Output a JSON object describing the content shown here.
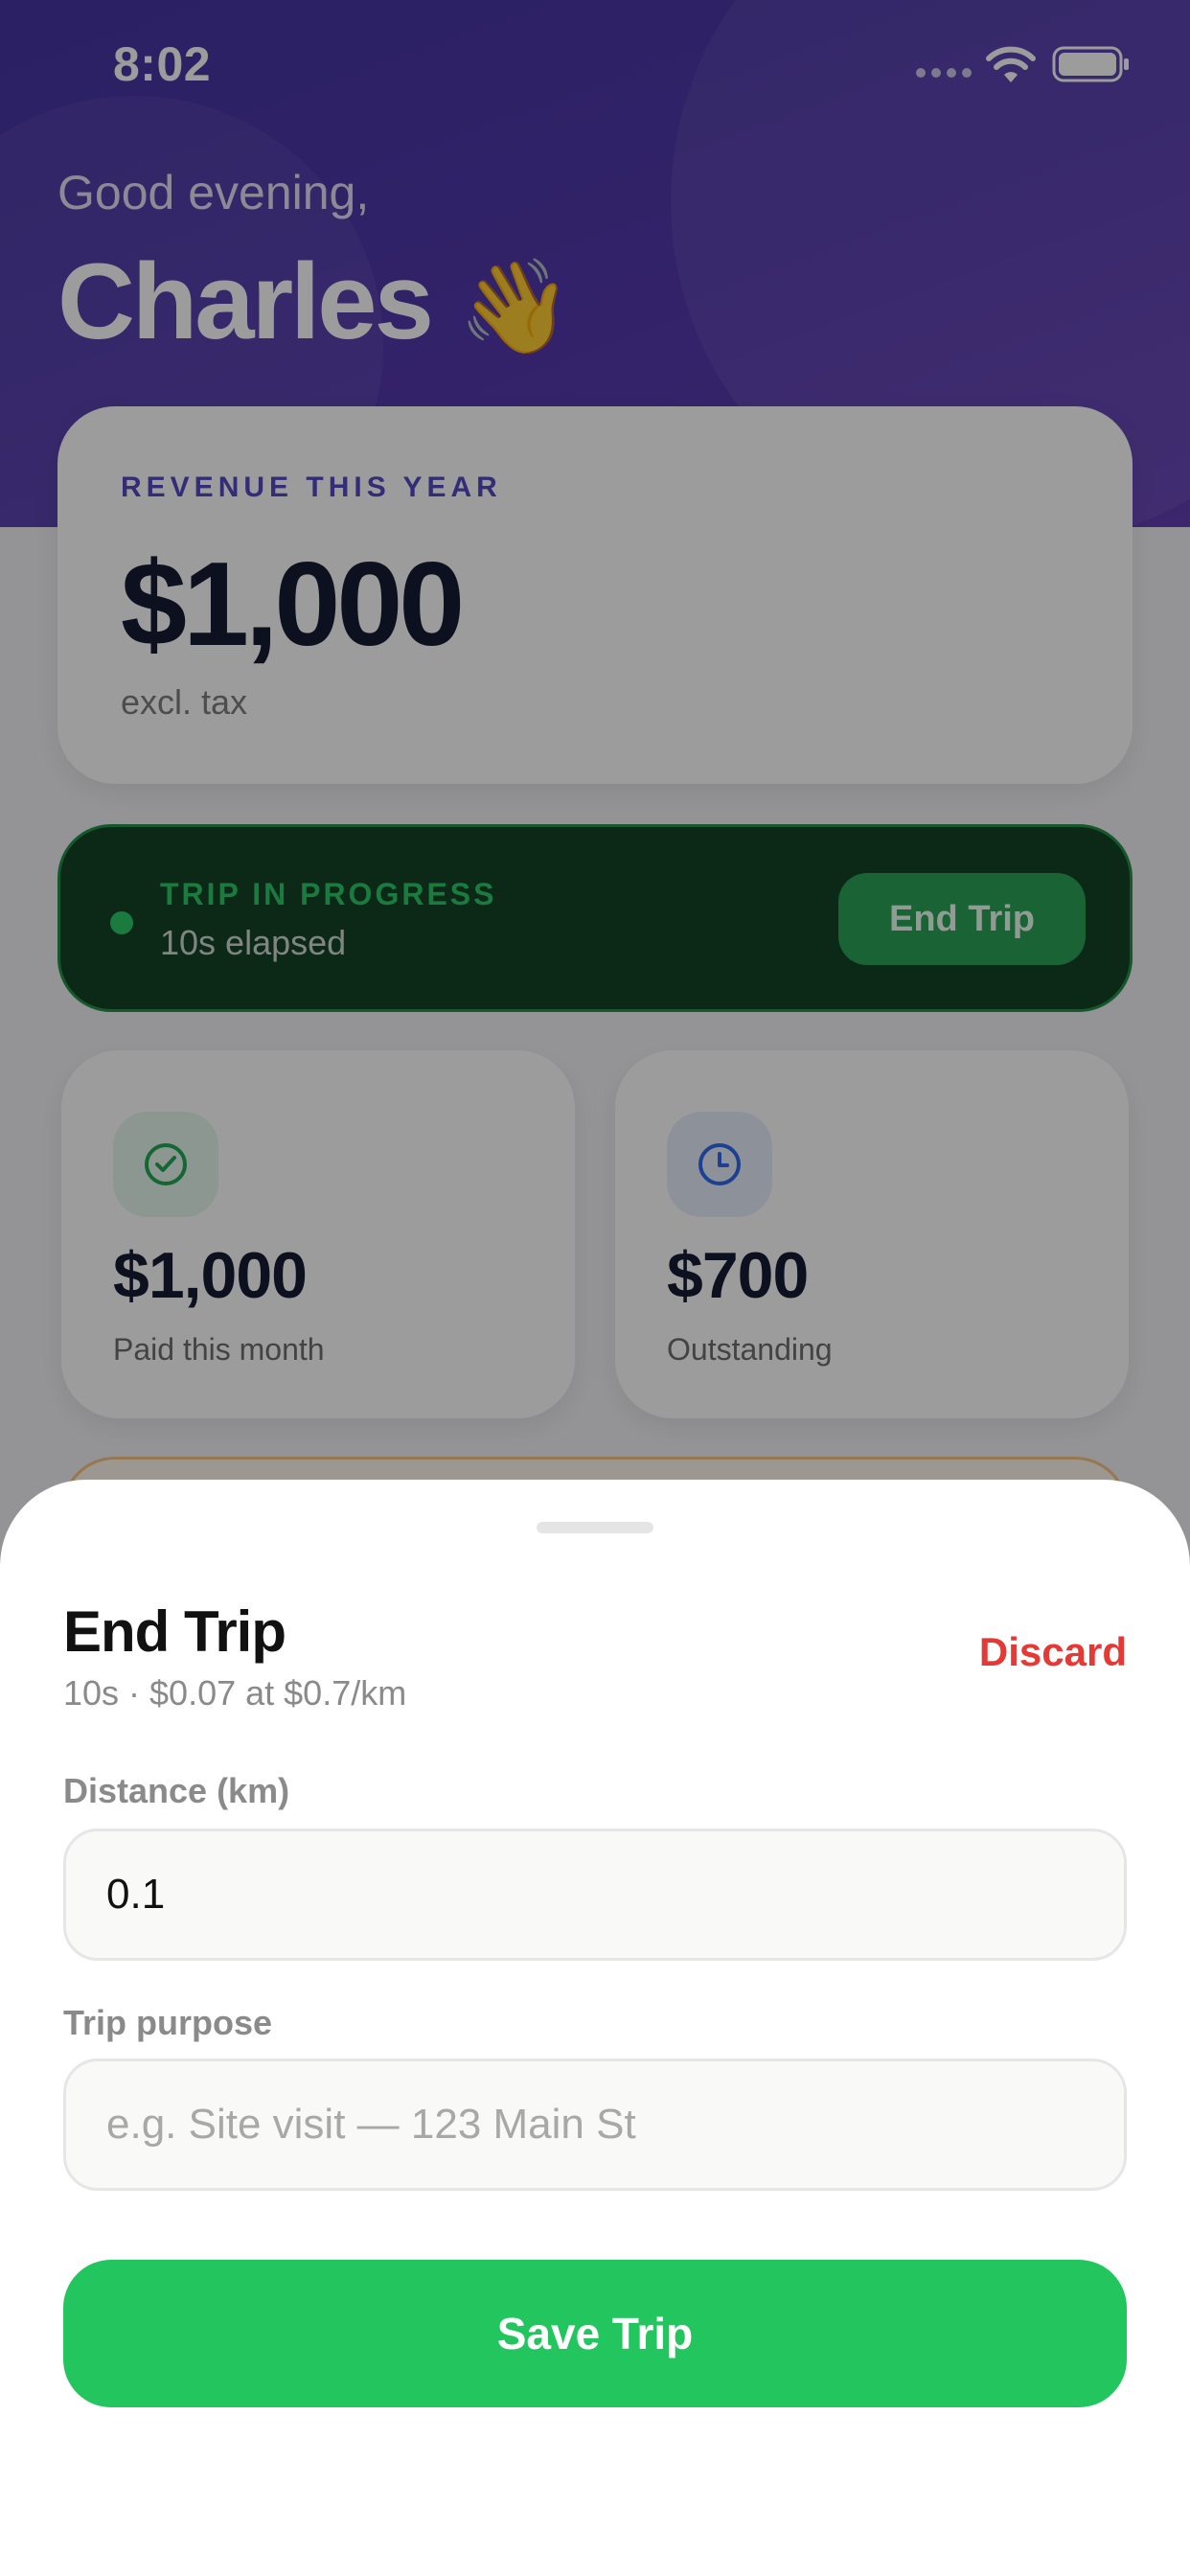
{
  "status_bar": {
    "time": "8:02"
  },
  "header": {
    "greeting": "Good evening,",
    "name": "Charles",
    "emoji": "👋"
  },
  "revenue": {
    "label": "REVENUE THIS YEAR",
    "amount": "$1,000",
    "sub": "excl. tax"
  },
  "trip": {
    "title": "TRIP IN PROGRESS",
    "elapsed": "10s elapsed",
    "end_label": "End Trip"
  },
  "stats": [
    {
      "value": "$1,000",
      "label": "Paid this month",
      "icon": "check-circle-icon"
    },
    {
      "value": "$700",
      "label": "Outstanding",
      "icon": "clock-icon"
    }
  ],
  "sheet": {
    "title": "End Trip",
    "subtitle": "10s · $0.07 at $0.7/km",
    "discard_label": "Discard",
    "distance_label": "Distance (km)",
    "distance_value": "0.1",
    "purpose_label": "Trip purpose",
    "purpose_placeholder": "e.g. Site visit — 123 Main St",
    "save_label": "Save Trip"
  },
  "colors": {
    "header": "#4a2ea8",
    "accent_green": "#22c55e",
    "danger": "#e53935",
    "revenue_label": "#4a3ec0"
  }
}
